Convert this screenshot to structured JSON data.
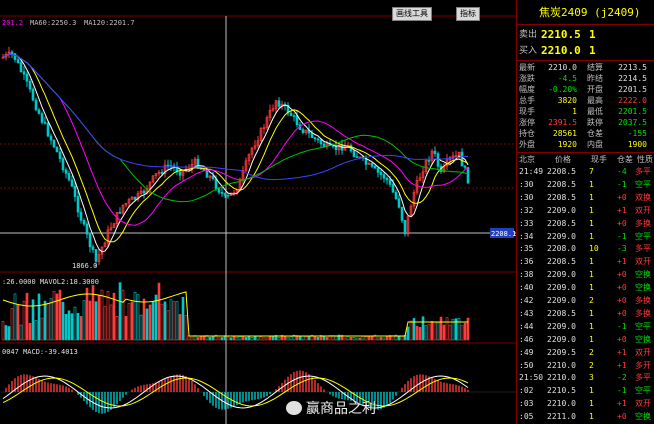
{
  "toolbar": {
    "btn1": "画线工具",
    "btn2": "指标"
  },
  "main": {
    "ma_label_prefix": "201.2",
    "ma60": "MA60:2250.3",
    "ma120": "MA120:2201.7",
    "low_label": "1866.0",
    "price_tag": "2208.1"
  },
  "vol": {
    "label": ":26.0000  MAVOL2:18.3000"
  },
  "macd": {
    "label": "0047  MACD:-39.4013"
  },
  "quote": {
    "title": "焦炭2409 (j2409)",
    "sell_label": "卖出",
    "sell_price": "2210.5",
    "sell_vol": "1",
    "buy_label": "买入",
    "buy_price": "2210.0",
    "buy_vol": "1",
    "rows": [
      [
        "最新",
        "2210.0",
        "结算",
        "2213.5"
      ],
      [
        "涨跌",
        "-4.5",
        "昨结",
        "2214.5"
      ],
      [
        "幅度",
        "-0.20%",
        "开盘",
        "2201.5"
      ],
      [
        "总手",
        "3820",
        "最高",
        "2222.0"
      ],
      [
        "现手",
        "1",
        "最低",
        "2201.5"
      ],
      [
        "涨停",
        "2391.5",
        "跌停",
        "2037.5"
      ],
      [
        "持仓",
        "28561",
        "仓差",
        "-155"
      ],
      [
        "外盘",
        "1920",
        "内盘",
        "1900"
      ]
    ],
    "tick_header": [
      "北京",
      "价格",
      "现手",
      "仓差",
      "性质"
    ],
    "ticks": [
      [
        "21:49",
        "2208.5",
        "7",
        "-4",
        "多平"
      ],
      [
        ":30",
        "2208.5",
        "1",
        "-1",
        "空平"
      ],
      [
        ":30",
        "2208.5",
        "1",
        "+0",
        "双换"
      ],
      [
        ":32",
        "2209.0",
        "1",
        "+1",
        "双开"
      ],
      [
        ":33",
        "2208.5",
        "1",
        "+0",
        "多换"
      ],
      [
        ":34",
        "2209.0",
        "1",
        "-1",
        "空平"
      ],
      [
        ":35",
        "2208.0",
        "10",
        "-3",
        "多平"
      ],
      [
        ":36",
        "2208.5",
        "1",
        "+1",
        "双开"
      ],
      [
        ":38",
        "2209.0",
        "1",
        "+0",
        "空换"
      ],
      [
        ":40",
        "2209.0",
        "1",
        "+0",
        "空换"
      ],
      [
        ":42",
        "2209.0",
        "2",
        "+0",
        "多换"
      ],
      [
        ":43",
        "2208.5",
        "1",
        "+0",
        "多换"
      ],
      [
        ":44",
        "2209.0",
        "1",
        "-1",
        "空平"
      ],
      [
        ":46",
        "2209.0",
        "1",
        "+0",
        "空换"
      ],
      [
        ":49",
        "2209.5",
        "2",
        "+1",
        "双开"
      ],
      [
        ":50",
        "2210.0",
        "2",
        "+1",
        "多开"
      ],
      [
        "21:50",
        "2210.0",
        "3",
        "-2",
        "多平"
      ],
      [
        ":02",
        "2210.5",
        "1",
        "-1",
        "空平"
      ],
      [
        ":03",
        "2210.0",
        "1",
        "+1",
        "双开"
      ],
      [
        ":05",
        "2211.0",
        "1",
        "+0",
        "空换"
      ]
    ]
  },
  "watermark": "赢商品之利",
  "colors": {
    "up": "#ff3b3b",
    "down": "#00c8c8",
    "ma1": "#ffffff",
    "ma2": "#ffff00",
    "ma3": "#ff00ff",
    "ma4": "#00c000",
    "ma5": "#4040ff"
  }
}
